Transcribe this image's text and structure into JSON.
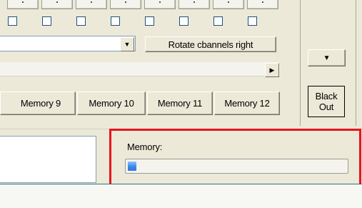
{
  "checkbox_row": {
    "count": 8
  },
  "channel_combo": {
    "value": "",
    "arrow_icon": "chevron-down-icon"
  },
  "buttons": {
    "rotate_channels_right": "Rotate cbannels right",
    "right_dropdown_icon": "chevron-down-icon",
    "black_out_line1": "Black",
    "black_out_line2": "Out"
  },
  "scrollbar": {
    "right_arrow_icon": "chevron-right-icon"
  },
  "memory_buttons": [
    "Memory 9",
    "Memory 10",
    "Memory 11",
    "Memory 12"
  ],
  "memory_panel": {
    "label": "Memory:",
    "progress_fraction": 0.04,
    "fill_color": "#3b86e8"
  },
  "annotation": {
    "highlight_color": "#e8141d"
  }
}
